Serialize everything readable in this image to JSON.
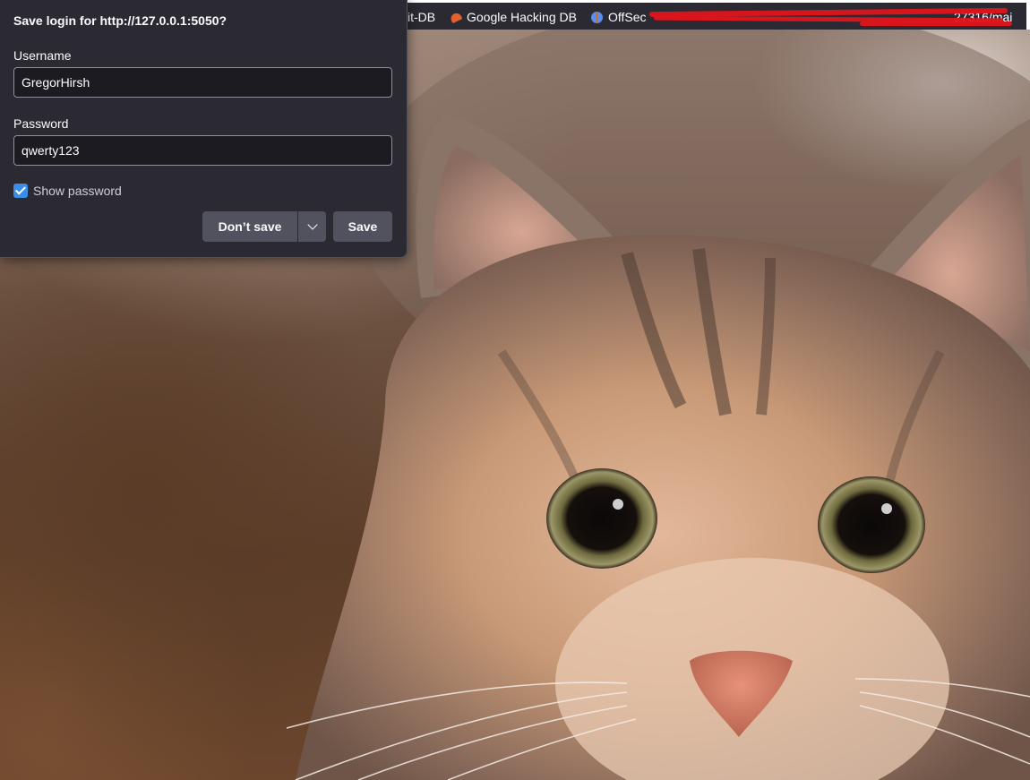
{
  "bookmarks_bar": {
    "items": [
      {
        "label": "it-DB",
        "icon": "none"
      },
      {
        "label": "Google Hacking DB",
        "icon": "ghdb-icon"
      },
      {
        "label": "OffSec",
        "icon": "offsec-icon"
      }
    ],
    "url_fragment": "27316/mai",
    "redaction_color": "#e0141c"
  },
  "popup": {
    "title": "Save login for http://127.0.0.1:5050?",
    "username_label": "Username",
    "username_value": "GregorHirsh",
    "password_label": "Password",
    "password_value": "qwerty123",
    "show_password_label": "Show password",
    "show_password_checked": true,
    "dont_save_label": "Don’t save",
    "save_label": "Save",
    "dropdown_icon": "chevron-down-icon",
    "accent_color": "#3a8ee6"
  },
  "background": {
    "description_icon": "cat-photo"
  }
}
